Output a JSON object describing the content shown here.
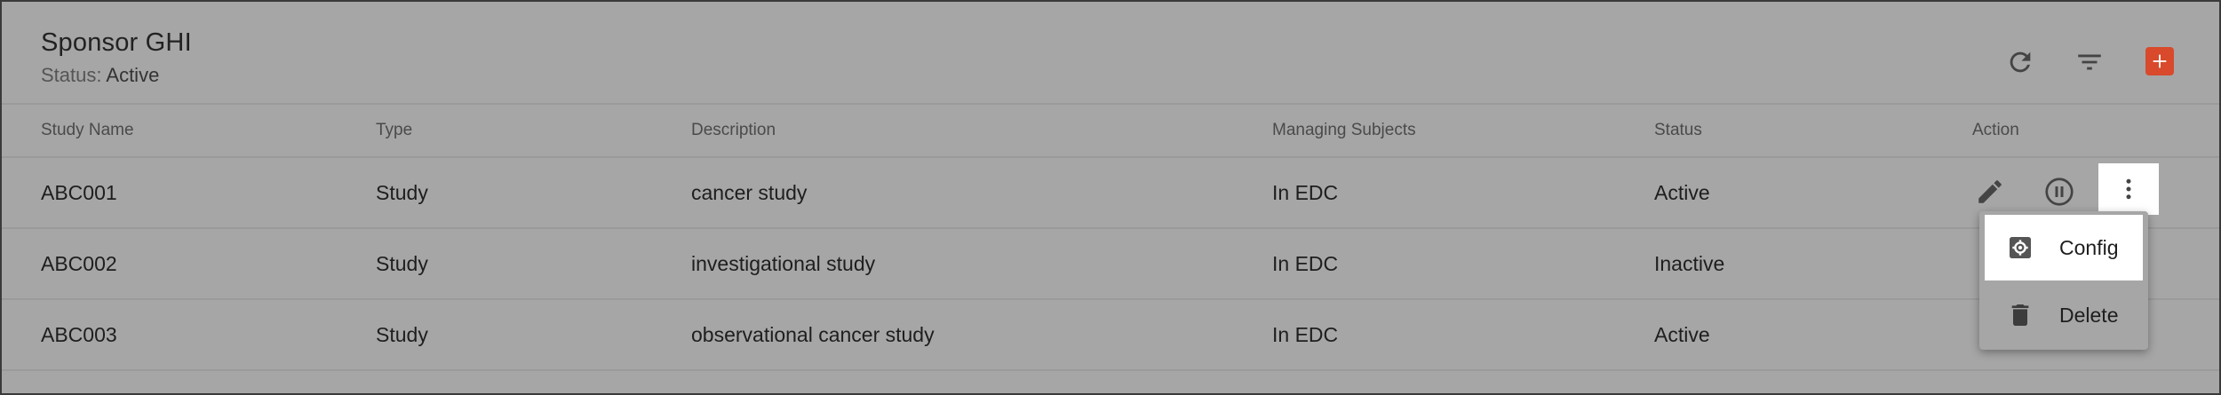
{
  "header": {
    "title": "Sponsor GHI",
    "status_label": "Status:",
    "status_value": "Active"
  },
  "toolbar": {
    "refresh_icon": "refresh-icon",
    "filter_icon": "filter-icon",
    "add_icon": "add-icon"
  },
  "columns": [
    "Study Name",
    "Type",
    "Description",
    "Managing Subjects",
    "Status",
    "Action"
  ],
  "rows": [
    {
      "study_name": "ABC001",
      "type": "Study",
      "description": "cancer study",
      "managing_subjects": "In EDC",
      "status": "Active"
    },
    {
      "study_name": "ABC002",
      "type": "Study",
      "description": "investigational study",
      "managing_subjects": "In EDC",
      "status": "Inactive"
    },
    {
      "study_name": "ABC003",
      "type": "Study",
      "description": "observational cancer study",
      "managing_subjects": "In EDC",
      "status": "Active"
    }
  ],
  "context_menu": {
    "items": [
      {
        "label": "Config",
        "icon": "settings-box-icon"
      },
      {
        "label": "Delete",
        "icon": "trash-icon"
      }
    ]
  },
  "colors": {
    "accent": "#d84a2b",
    "overlay": "#a6a6a6"
  }
}
